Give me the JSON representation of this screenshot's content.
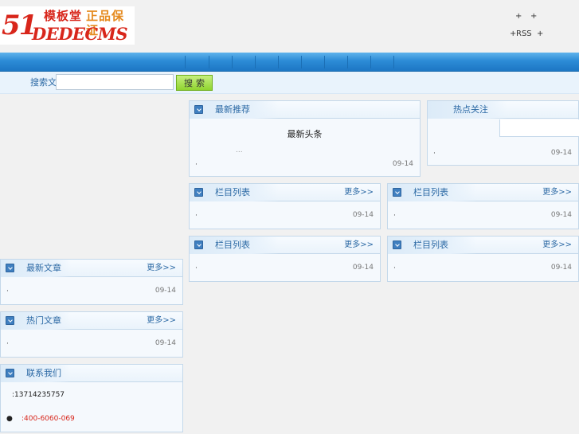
{
  "header": {
    "logo": {
      "number": "51",
      "tagline_left": "模板堂",
      "tagline_right": "正品保证",
      "brand": "DEDECMS"
    },
    "top_links": {
      "plus_1": "+",
      "plus_2": "+",
      "plus_3": "+",
      "rss": "RSS",
      "plus_4": "+"
    }
  },
  "search": {
    "label": "搜索文章",
    "input_value": "",
    "input_placeholder": "",
    "button_label": "搜索"
  },
  "panels": {
    "main_featured": {
      "title": "最新推荐",
      "headline": "最新头条",
      "ellipsis": "...",
      "bullet": "·",
      "date": "09-14"
    },
    "right_top": {
      "title": "热点关注",
      "bullet": "·",
      "date": "09-14"
    },
    "mid_left_1": {
      "title": "栏目列表",
      "more": "更多>>",
      "bullet": "·",
      "date": "09-14"
    },
    "mid_right_1": {
      "title": "栏目列表",
      "more": "更多>>",
      "bullet": "·",
      "date": "09-14"
    },
    "mid_left_2": {
      "title": "栏目列表",
      "more": "更多>>",
      "bullet": "·",
      "date": "09-14"
    },
    "mid_right_2": {
      "title": "栏目列表",
      "more": "更多>>",
      "bullet": "·",
      "date": "09-14"
    },
    "left_1": {
      "title": "最新文章",
      "more": "更多>>",
      "bullet": "·",
      "date": "09-14"
    },
    "left_2": {
      "title": "热门文章",
      "more": "更多>>",
      "bullet": "·",
      "date": "09-14"
    },
    "contact": {
      "title": "联系我们",
      "phone_line": ":13714235757",
      "hotline_bullet": "●",
      "hotline": ":400-6060-069"
    }
  },
  "colors": {
    "nav_blue": "#2c8bd6",
    "title_blue": "#2d6aa5",
    "hotline_red": "#d8261b",
    "search_button_green": "#8fd430"
  }
}
